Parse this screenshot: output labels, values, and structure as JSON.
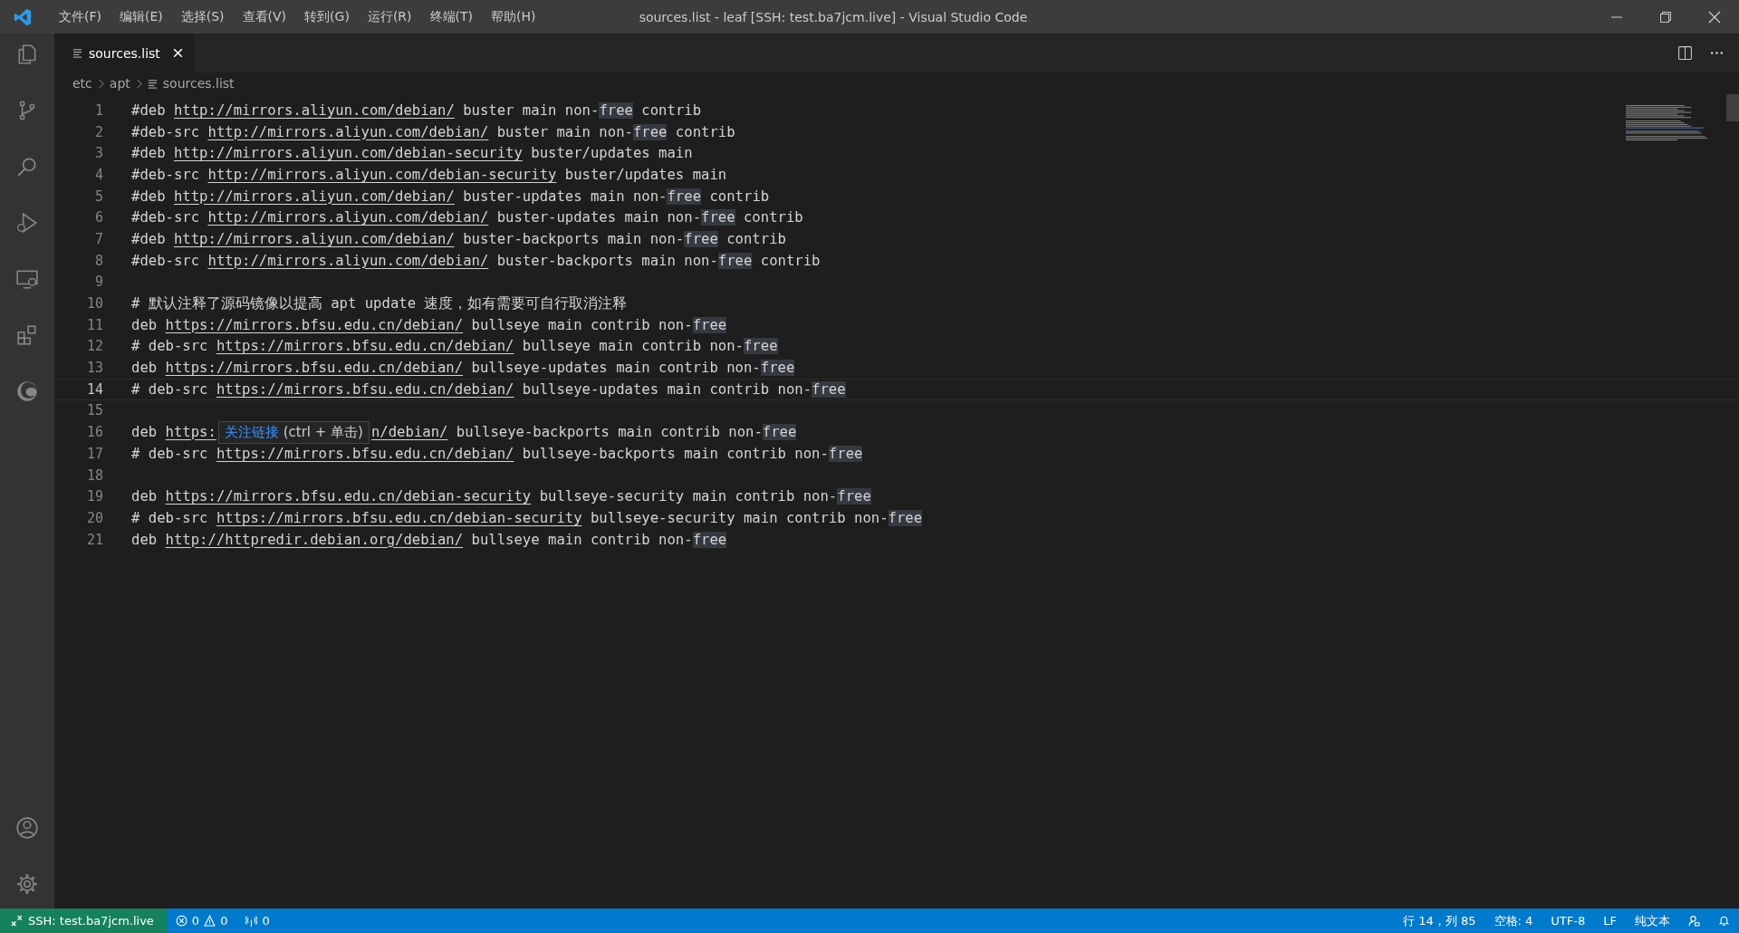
{
  "window": {
    "title": "sources.list - leaf [SSH: test.ba7jcm.live] - Visual Studio Code"
  },
  "menu": [
    "文件(F)",
    "编辑(E)",
    "选择(S)",
    "查看(V)",
    "转到(G)",
    "运行(R)",
    "终端(T)",
    "帮助(H)"
  ],
  "tabs": [
    {
      "label": "sources.list",
      "selected": true
    }
  ],
  "breadcrumbs": [
    "etc",
    "apt",
    "sources.list"
  ],
  "editor": {
    "lines": [
      {
        "number": "1",
        "prefix": "#deb ",
        "link": "http://mirrors.aliyun.com/debian/",
        "rest": " buster main non-",
        "highlight": "free",
        "tail": " contrib",
        "current": false
      },
      {
        "number": "2",
        "prefix": "#deb-src ",
        "link": "http://mirrors.aliyun.com/debian/",
        "rest": " buster main non-",
        "highlight": "free",
        "tail": " contrib",
        "current": false
      },
      {
        "number": "3",
        "prefix": "#deb ",
        "link": "http://mirrors.aliyun.com/debian-security",
        "rest": " buster/updates main",
        "current": false
      },
      {
        "number": "4",
        "prefix": "#deb-src ",
        "link": "http://mirrors.aliyun.com/debian-security",
        "rest": " buster/updates main",
        "current": false
      },
      {
        "number": "5",
        "prefix": "#deb ",
        "link": "http://mirrors.aliyun.com/debian/",
        "rest": " buster-updates main non-",
        "highlight": "free",
        "tail": " contrib",
        "current": false
      },
      {
        "number": "6",
        "prefix": "#deb-src ",
        "link": "http://mirrors.aliyun.com/debian/",
        "rest": " buster-updates main non-",
        "highlight": "free",
        "tail": " contrib",
        "current": false
      },
      {
        "number": "7",
        "prefix": "#deb ",
        "link": "http://mirrors.aliyun.com/debian/",
        "rest": " buster-backports main non-",
        "highlight": "free",
        "tail": " contrib",
        "current": false
      },
      {
        "number": "8",
        "prefix": "#deb-src ",
        "link": "http://mirrors.aliyun.com/debian/",
        "rest": " buster-backports main non-",
        "highlight": "free",
        "tail": " contrib",
        "current": false
      },
      {
        "number": "9",
        "current": false
      },
      {
        "number": "10",
        "prefix": "# 默认注释了源码镜像以提高 apt update 速度，如有需要可自行取消注释",
        "current": false
      },
      {
        "number": "11",
        "prefix": "deb ",
        "link": "https://mirrors.bfsu.edu.cn/debian/",
        "rest": " bullseye main contrib non-",
        "highlight": "free",
        "current": false
      },
      {
        "number": "12",
        "prefix": "# deb-src ",
        "link": "https://mirrors.bfsu.edu.cn/debian/",
        "rest": " bullseye main contrib non-",
        "highlight": "free",
        "current": false
      },
      {
        "number": "13",
        "prefix": "deb ",
        "link": "https://mirrors.bfsu.edu.cn/debian/",
        "rest": " bullseye-updates main contrib non-",
        "highlight": "free",
        "current": false
      },
      {
        "number": "14",
        "prefix": "# deb-src ",
        "link": "https://mirrors.bfsu.edu.cn/debian/",
        "rest": " bullseye-updates main contrib non-",
        "highlight": "free",
        "current": true
      },
      {
        "number": "15",
        "current": false
      },
      {
        "number": "16",
        "prefix": "deb ",
        "link": "https:",
        "tooltip": {
          "action": "关注链接",
          "keys": "(ctrl + 单击)"
        },
        "link_tail": "n/debian/",
        "rest": " bullseye-backports main contrib non-",
        "highlight": "free",
        "current": false
      },
      {
        "number": "17",
        "prefix": "# deb-src ",
        "link": "https://mirrors.bfsu.edu.cn/debian/",
        "rest": " bullseye-backports main contrib non-",
        "highlight": "free",
        "current": false
      },
      {
        "number": "18",
        "current": false
      },
      {
        "number": "19",
        "prefix": "deb ",
        "link": "https://mirrors.bfsu.edu.cn/debian-security",
        "rest": " bullseye-security main contrib non-",
        "highlight": "free",
        "current": false
      },
      {
        "number": "20",
        "prefix": "# deb-src ",
        "link": "https://mirrors.bfsu.edu.cn/debian-security",
        "rest": " bullseye-security main contrib non-",
        "highlight": "free",
        "current": false
      },
      {
        "number": "21",
        "prefix": "deb ",
        "link": "http://httpredir.debian.org/debian/",
        "rest": " bullseye main contrib non-",
        "highlight": "free",
        "current": false
      }
    ]
  },
  "status_bar": {
    "remote": "SSH: test.ba7jcm.live",
    "errors": "0",
    "warnings": "0",
    "ports": "0",
    "position": "行 14，列 85",
    "indent": "空格: 4",
    "encoding": "UTF-8",
    "eol": "LF",
    "language": "纯文本"
  }
}
